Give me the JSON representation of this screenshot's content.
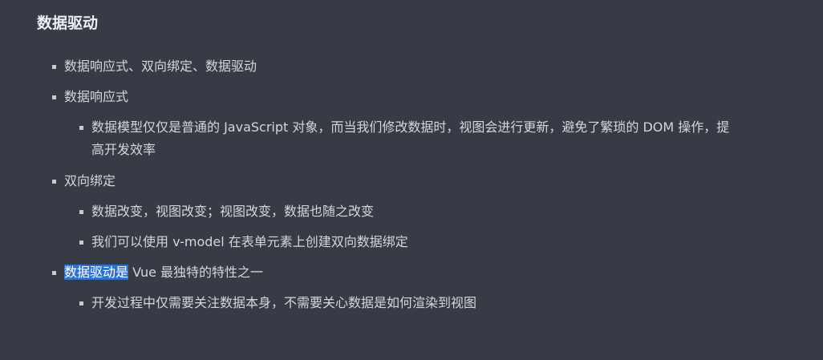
{
  "heading": "数据驱动",
  "items": [
    {
      "text": "数据响应式、双向绑定、数据驱动"
    },
    {
      "text": "数据响应式"
    },
    {
      "line1": "数据模型仅仅是普通的 JavaScript 对象，而当我们修改数据时，视图会进行更新，避免了繁琐的 DOM 操作，提",
      "line2": "高开发效率"
    },
    {
      "text": "双向绑定"
    },
    {
      "text": "数据改变，视图改变；视图改变，数据也随之改变"
    },
    {
      "text": "我们可以使用 v-model 在表单元素上创建双向数据绑定"
    },
    {
      "highlighted": "数据驱动是",
      "rest": " Vue 最独特的特性之一"
    },
    {
      "text": "开发过程中仅需要关注数据本身，不需要关心数据是如何渲染到视图"
    }
  ],
  "colors": {
    "background": "#363b46",
    "text": "#d3d6dc",
    "selection": "#2f73c9"
  }
}
